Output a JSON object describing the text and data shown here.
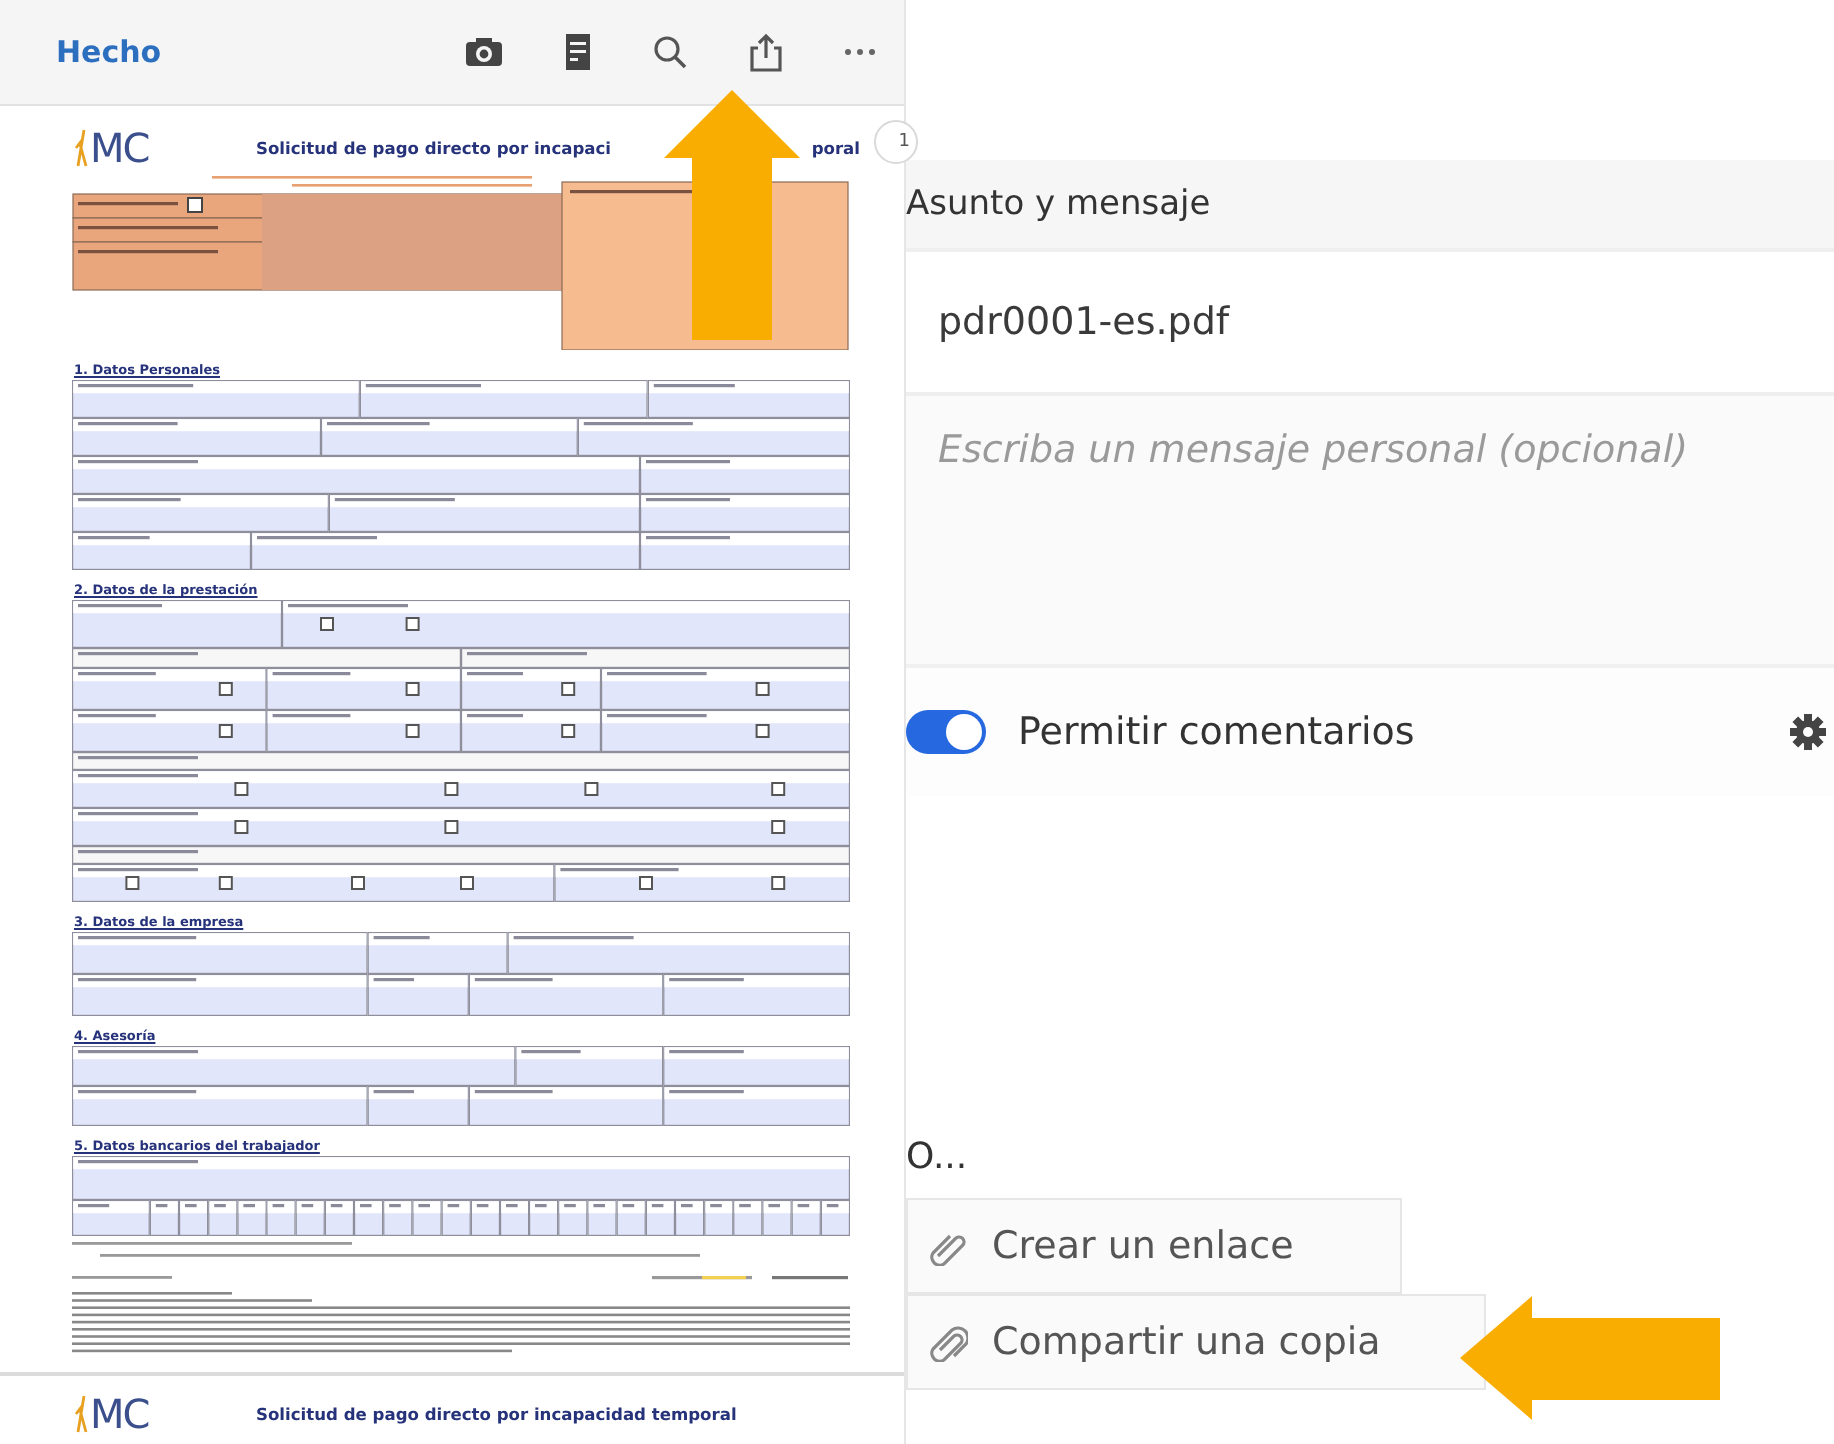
{
  "toolbar": {
    "done": "Hecho"
  },
  "pages": [
    {
      "logo": "MC",
      "title": "Solicitud de pago directo por incapaci",
      "title_tail": "poral",
      "sections": [
        {
          "heading": "1. Datos Personales"
        },
        {
          "heading": "2. Datos de la prestación"
        },
        {
          "heading": "3. Datos de la empresa"
        },
        {
          "heading": "4. Asesoría"
        },
        {
          "heading": "5. Datos bancarios del trabajador"
        }
      ]
    },
    {
      "logo": "MC",
      "title": "Solicitud de pago directo por incapacidad temporal"
    }
  ],
  "page_badge": "1",
  "share": {
    "heading": "Asunto y mensaje",
    "subject": "pdr0001-es.pdf",
    "message_placeholder": "Escriba un mensaje personal (opcional)",
    "allow_comments": {
      "label": "Permitir comentarios",
      "on": true
    },
    "options_heading": "O...",
    "options": [
      {
        "label": "Crear un enlace"
      },
      {
        "label": "Compartir una copia"
      }
    ]
  }
}
